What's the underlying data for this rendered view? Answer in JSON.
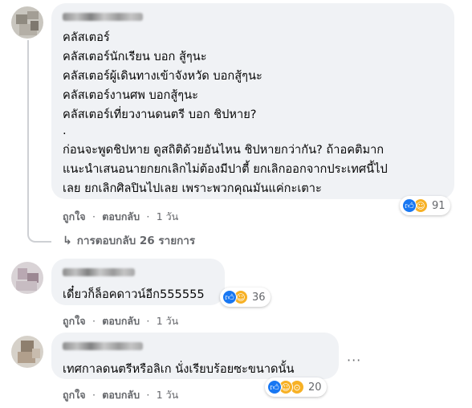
{
  "comments": [
    {
      "lines": [
        "คลัสเตอร์",
        "คลัสเตอร์นักเรียน บอก สู้ๆนะ",
        "คลัสเตอร์ผู้เดินทางเข้าจังหวัด บอกสู้ๆนะ",
        "คลัสเตอร์งานศพ บอกสู้ๆนะ",
        "คลัสเตอร์เที่ยวงานดนตรี บอก ชิปหาย?",
        ".",
        "ก่อนจะพูดชิปหาย ดูสถิติด้วยอันไหน ชิปหายกว่ากัน? ถ้าอคติมาก",
        "แนะนำเสนอนายกยกเลิกไม่ต้องมีปาตี้ ยกเลิกออกจากประเทศนี้ไป",
        "เลย ยกเลิกศิลปินไปเลย เพราะพวกคุณมันแค่กะเตาะ"
      ],
      "like_label": "ถูกใจ",
      "reply_label": "ตอบกลับ",
      "time": "1 วัน",
      "reaction_icons": [
        "like-icon",
        "haha-icon"
      ],
      "reaction_count": "91"
    },
    {
      "lines": [
        "เดี๋ยวก็ล็อคดาวน์อีก555555"
      ],
      "like_label": "ถูกใจ",
      "reply_label": "ตอบกลับ",
      "time": "1 วัน",
      "reaction_icons": [
        "like-icon",
        "haha-icon"
      ],
      "reaction_count": "36"
    },
    {
      "lines": [
        "เทศกาลดนตรีหรือลิเก นั่งเรียบร้อยซะขนาดนั้น"
      ],
      "like_label": "ถูกใจ",
      "reply_label": "ตอบกลับ",
      "time": "1 วัน",
      "reaction_icons": [
        "like-icon",
        "haha-icon",
        "wow-icon"
      ],
      "reaction_count": "20"
    }
  ],
  "replies_link": "การตอบกลับ 26 รายการ",
  "separator": "·",
  "more_options": "···",
  "colors": {
    "bubble": "#f0f2f5",
    "meta_text": "#65676b",
    "like_blue": "#1877f2",
    "haha_yellow": "#f7b125"
  }
}
